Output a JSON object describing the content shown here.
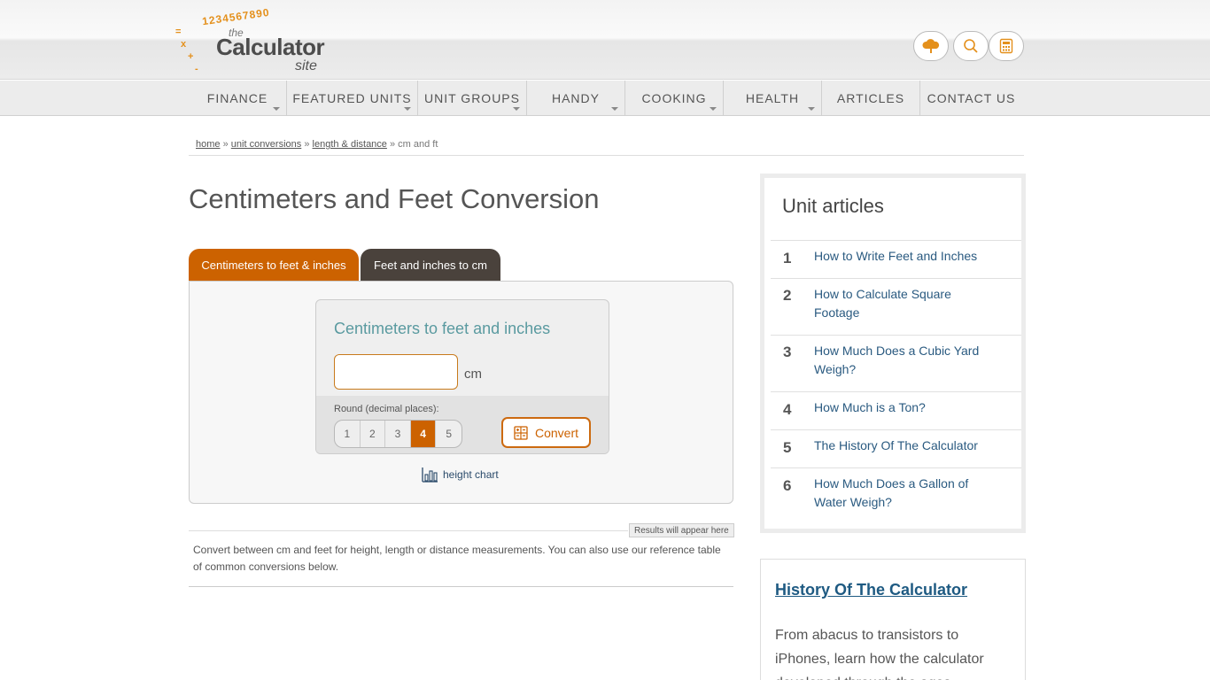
{
  "logo": {
    "digits": "1234567890",
    "the": "the",
    "name": "Calculator",
    "site": "site"
  },
  "header_buttons": [
    {
      "name": "cloud-icon",
      "label": "cloud"
    },
    {
      "name": "search-icon",
      "label": "search"
    },
    {
      "name": "calculator-icon",
      "label": "calculator"
    }
  ],
  "nav": [
    {
      "label": "Finance",
      "dropdown": true
    },
    {
      "label": "Featured Units",
      "dropdown": true
    },
    {
      "label": "Unit Groups",
      "dropdown": true
    },
    {
      "label": "Handy",
      "dropdown": true
    },
    {
      "label": "Cooking",
      "dropdown": true
    },
    {
      "label": "Health",
      "dropdown": true
    },
    {
      "label": "Articles",
      "dropdown": false
    },
    {
      "label": "Contact Us",
      "dropdown": false
    }
  ],
  "breadcrumb": {
    "home": "home",
    "unit_conversions": "unit conversions",
    "length_distance": "length & distance",
    "current": "cm and ft",
    "sep": "»"
  },
  "page_title": "Centimeters and Feet Conversion",
  "tabs": {
    "cm_to_ft": "Centimeters to feet & inches",
    "ft_to_cm": "Feet and inches to cm"
  },
  "calculator": {
    "title": "Centimeters to feet and inches",
    "input_value": "",
    "unit": "cm",
    "round_label": "Round (decimal places):",
    "round_options": [
      "1",
      "2",
      "3",
      "4",
      "5"
    ],
    "round_selected": "4",
    "convert_label": "Convert"
  },
  "height_chart_label": "height chart",
  "results_tag": "Results will appear here",
  "description": "Convert between cm and feet for height, length or distance measurements. You can also use our reference table of common conversions below.",
  "unit_articles": {
    "title": "Unit articles",
    "items": [
      {
        "num": "1",
        "title": "How to Write Feet and Inches"
      },
      {
        "num": "2",
        "title": "How to Calculate Square Footage"
      },
      {
        "num": "3",
        "title": "How Much Does a Cubic Yard Weigh?"
      },
      {
        "num": "4",
        "title": "How Much is a Ton?"
      },
      {
        "num": "5",
        "title": "The History Of The Calculator"
      },
      {
        "num": "6",
        "title": "How Much Does a Gallon of Water Weigh?"
      }
    ]
  },
  "history": {
    "title": "History Of The Calculator",
    "text": "From abacus to transistors to iPhones, learn how the calculator developed through the ages."
  },
  "colors": {
    "accent": "#cc6200",
    "dark_tab": "#4a423c",
    "link": "#2a5a80",
    "teal": "#5a9aa0"
  }
}
